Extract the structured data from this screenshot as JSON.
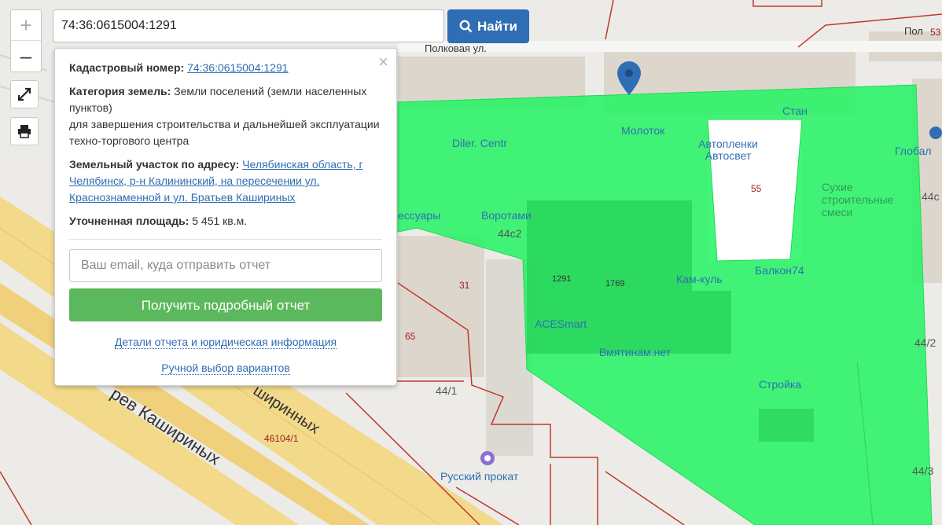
{
  "search": {
    "value": "74:36:0615004:1291",
    "button_label": "Найти"
  },
  "zoom": {
    "in": "+",
    "out": "–"
  },
  "popup": {
    "close": "×",
    "cadastral_label": "Кадастровый номер:",
    "cadastral_value": "74:36:0615004:1291",
    "category_label": "Категория земель:",
    "category_value": "Земли поселений (земли населенных пунктов)",
    "category_usage": "для завершения строительства и дальнейшей эксплуатации техно-торгового центра",
    "address_label": "Земельный участок по адресу:",
    "address_value": "Челябинская область, г Челябинск, р-н Калининский, на пересечении ул. Краснознаменной и ул. Братьев Кашириных",
    "area_label": "Уточненная площадь:",
    "area_value": "5 451 кв.м.",
    "email_placeholder": "Ваш email, куда отправить отчет",
    "report_button": "Получить подробный отчет",
    "details_link": "Детали отчета и юридическая информация",
    "manual_link": "Ручной выбор вариантов"
  },
  "map": {
    "highlight_color": "#22f562",
    "boundary_color": "#c0392b",
    "streets": [
      "Полковая ул.",
      "Пол",
      "53",
      "рев Кашириных",
      "ширинных",
      "Кашириных"
    ],
    "pois": [
      "Diler. Centr",
      "Молоток",
      "Стан",
      "Автопленки Автосвет",
      "Глобал",
      "Сухие строительные смеси",
      "Воротами",
      "ессуары",
      "Кам-куль",
      "Балкон74",
      "ACESmart",
      "Вмятинам.нет",
      "Стройка",
      "Русский прокат"
    ],
    "numbers": [
      "55",
      "44с",
      "44с2",
      "31",
      "65",
      "44/1",
      "44/2",
      "44/3",
      "1291",
      "1769",
      "46104/1"
    ]
  }
}
